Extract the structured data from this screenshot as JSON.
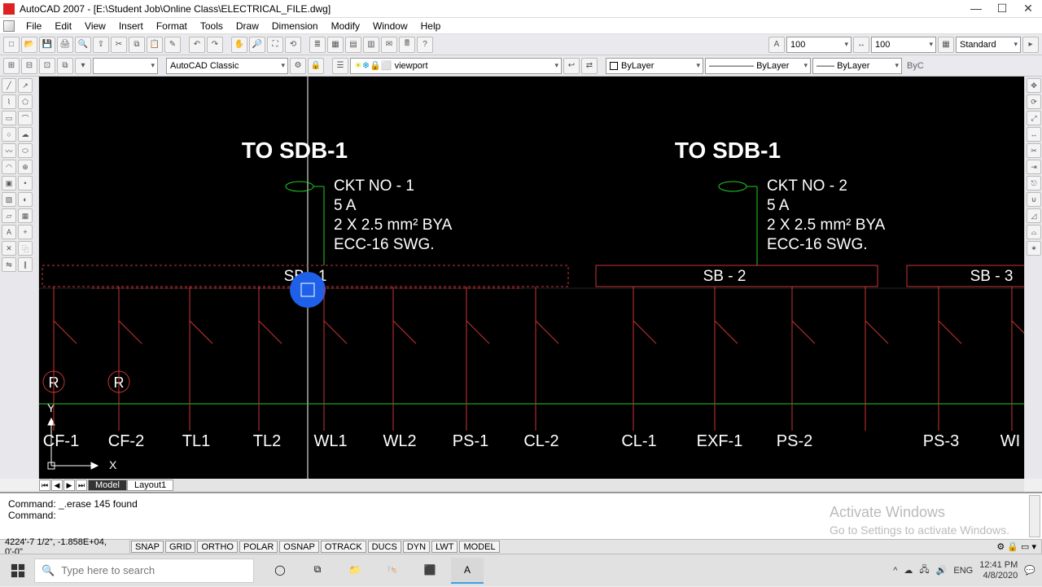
{
  "titlebar": {
    "title": "AutoCAD 2007 - [E:\\Student Job\\Online Class\\ELECTRICAL_FILE.dwg]"
  },
  "menu": {
    "items": [
      "File",
      "Edit",
      "View",
      "Insert",
      "Format",
      "Tools",
      "Draw",
      "Dimension",
      "Modify",
      "Window",
      "Help"
    ]
  },
  "toolbar_row1": {
    "textscale1": "100",
    "textscale2": "100",
    "dimstyle": "Standard"
  },
  "toolbar_row2": {
    "workspace": "AutoCAD Classic",
    "layerstate": "viewport",
    "linetype": "ByLayer",
    "lineweight": "ByLayer",
    "plotstyle": "ByC"
  },
  "drawing": {
    "header1": "TO SDB-1",
    "header2": "TO SDB-1",
    "ckt1": {
      "no": "CKT NO - 1",
      "amp": "5 A",
      "wire": "2 X 2.5 mm² BYA",
      "ecc": "ECC-16 SWG."
    },
    "ckt2": {
      "no": "CKT NO - 2",
      "amp": "5 A",
      "wire": "2 X 2.5 mm² BYA",
      "ecc": "ECC-16 SWG."
    },
    "sb1": "SB - 1",
    "sb2": "SB - 2",
    "sb3": "SB - 3",
    "devices_left": [
      "CF-1",
      "CF-2",
      "TL1",
      "TL2",
      "WL1",
      "WL2",
      "PS-1",
      "CL-2"
    ],
    "devices_right": [
      "CL-1",
      "EXF-1",
      "PS-2",
      "PS-3",
      "WI"
    ],
    "r_label": "R",
    "axis_x": "X",
    "axis_y": "Y"
  },
  "layout_tabs": {
    "model": "Model",
    "layout1": "Layout1"
  },
  "command": {
    "line1": "Command: _.erase 145 found",
    "line2": "Command:"
  },
  "watermark": {
    "big": "Activate Windows",
    "small": "Go to Settings to activate Windows."
  },
  "status": {
    "coords": "4224'-7 1/2\", -1.858E+04, 0'-0\"",
    "toggles": [
      "SNAP",
      "GRID",
      "ORTHO",
      "POLAR",
      "OSNAP",
      "OTRACK",
      "DUCS",
      "DYN",
      "LWT",
      "MODEL"
    ]
  },
  "taskbar": {
    "search_placeholder": "Type here to search",
    "time": "12:41 PM",
    "date": "4/8/2020"
  }
}
